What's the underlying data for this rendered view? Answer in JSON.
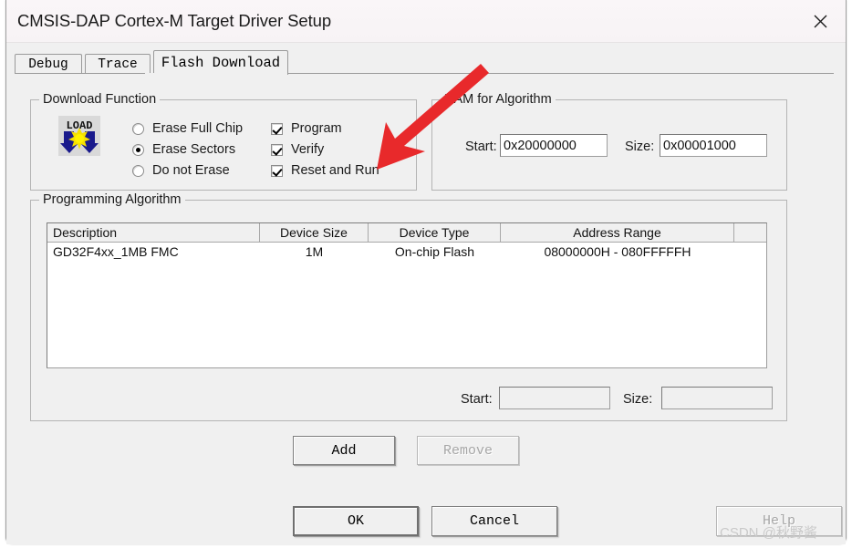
{
  "window": {
    "title": "CMSIS-DAP Cortex-M Target Driver Setup",
    "close_icon": "close-icon"
  },
  "tabs": [
    {
      "label": "Debug",
      "active": false
    },
    {
      "label": "Trace",
      "active": false
    },
    {
      "label": "Flash Download",
      "active": true
    }
  ],
  "download_function": {
    "title": "Download Function",
    "icon_text": "LOAD",
    "radios": [
      {
        "label": "Erase Full Chip",
        "checked": false
      },
      {
        "label": "Erase Sectors",
        "checked": true
      },
      {
        "label": "Do not Erase",
        "checked": false
      }
    ],
    "checkboxes": [
      {
        "label": "Program",
        "checked": true
      },
      {
        "label": "Verify",
        "checked": true
      },
      {
        "label": "Reset and Run",
        "checked": true
      }
    ]
  },
  "ram_for_algorithm": {
    "title": "RAM for Algorithm",
    "start_label": "Start:",
    "start_value": "0x20000000",
    "size_label": "Size:",
    "size_value": "0x00001000"
  },
  "programming_algorithm": {
    "title": "Programming Algorithm",
    "columns": [
      "Description",
      "Device Size",
      "Device Type",
      "Address Range"
    ],
    "rows": [
      {
        "description": "GD32F4xx_1MB FMC",
        "device_size": "1M",
        "device_type": "On-chip Flash",
        "address_range": "08000000H - 080FFFFFH"
      }
    ],
    "start_label": "Start:",
    "start_value": "",
    "size_label": "Size:",
    "size_value": ""
  },
  "buttons": {
    "add": {
      "label": "Add",
      "enabled": true
    },
    "remove": {
      "label": "Remove",
      "enabled": false
    },
    "ok": {
      "label": "OK",
      "enabled": true
    },
    "cancel": {
      "label": "Cancel",
      "enabled": true
    },
    "help": {
      "label": "Help",
      "enabled": false
    }
  },
  "annotation": {
    "arrow_color": "#e8292b",
    "arrow_name": "red-pointer-arrow"
  },
  "watermark": {
    "text": "CSDN @秋野酱"
  }
}
